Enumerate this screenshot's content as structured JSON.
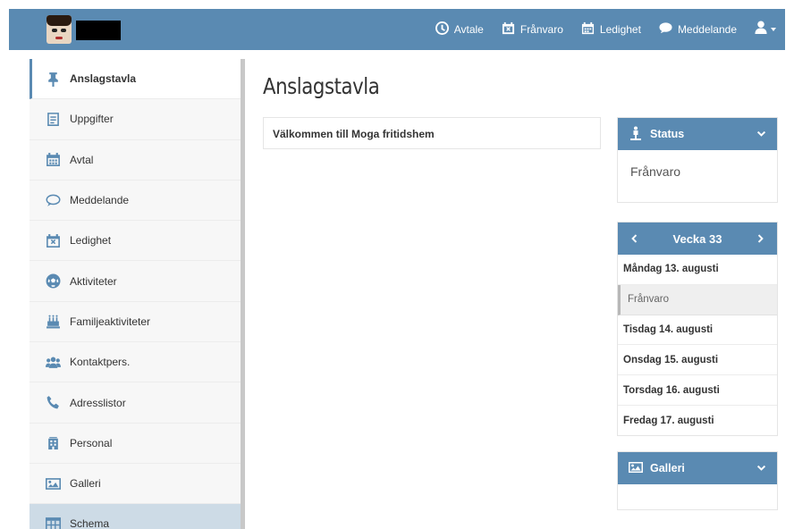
{
  "topbar": {
    "nav": [
      {
        "label": "Avtale",
        "icon": "clock-icon"
      },
      {
        "label": "Frånvaro",
        "icon": "calendar-x-icon"
      },
      {
        "label": "Ledighet",
        "icon": "calendar-grid-icon"
      },
      {
        "label": "Meddelande",
        "icon": "chat-bubble-icon"
      }
    ],
    "user_icon": "user-icon"
  },
  "sidebar": {
    "items": [
      {
        "label": "Anslagstavla",
        "icon": "pin-icon"
      },
      {
        "label": "Uppgifter",
        "icon": "clipboard-icon"
      },
      {
        "label": "Avtal",
        "icon": "calendar-icon"
      },
      {
        "label": "Meddelande",
        "icon": "chat-bubble-icon"
      },
      {
        "label": "Ledighet",
        "icon": "calendar-x-icon"
      },
      {
        "label": "Aktiviteter",
        "icon": "soccer-ball-icon"
      },
      {
        "label": "Familjeaktiviteter",
        "icon": "cake-icon"
      },
      {
        "label": "Kontaktpers.",
        "icon": "users-icon"
      },
      {
        "label": "Adresslistor",
        "icon": "phone-icon"
      },
      {
        "label": "Personal",
        "icon": "building-icon"
      },
      {
        "label": "Galleri",
        "icon": "image-icon"
      },
      {
        "label": "Schema",
        "icon": "table-icon"
      }
    ]
  },
  "main": {
    "title": "Anslagstavla",
    "welcome": "Välkommen till Moga fritidshem"
  },
  "status_panel": {
    "title": "Status",
    "value": "Frånvaro"
  },
  "week_panel": {
    "title": "Vecka 33",
    "days": [
      {
        "label": "Måndag 13. augusti",
        "entry": "Frånvaro"
      },
      {
        "label": "Tisdag 14. augusti"
      },
      {
        "label": "Onsdag 15. augusti"
      },
      {
        "label": "Torsdag 16. augusti"
      },
      {
        "label": "Fredag 17. augusti"
      }
    ]
  },
  "gallery_panel": {
    "title": "Galleri"
  },
  "colors": {
    "brand": "#5a8ab2",
    "hover": "#cddbe6"
  }
}
